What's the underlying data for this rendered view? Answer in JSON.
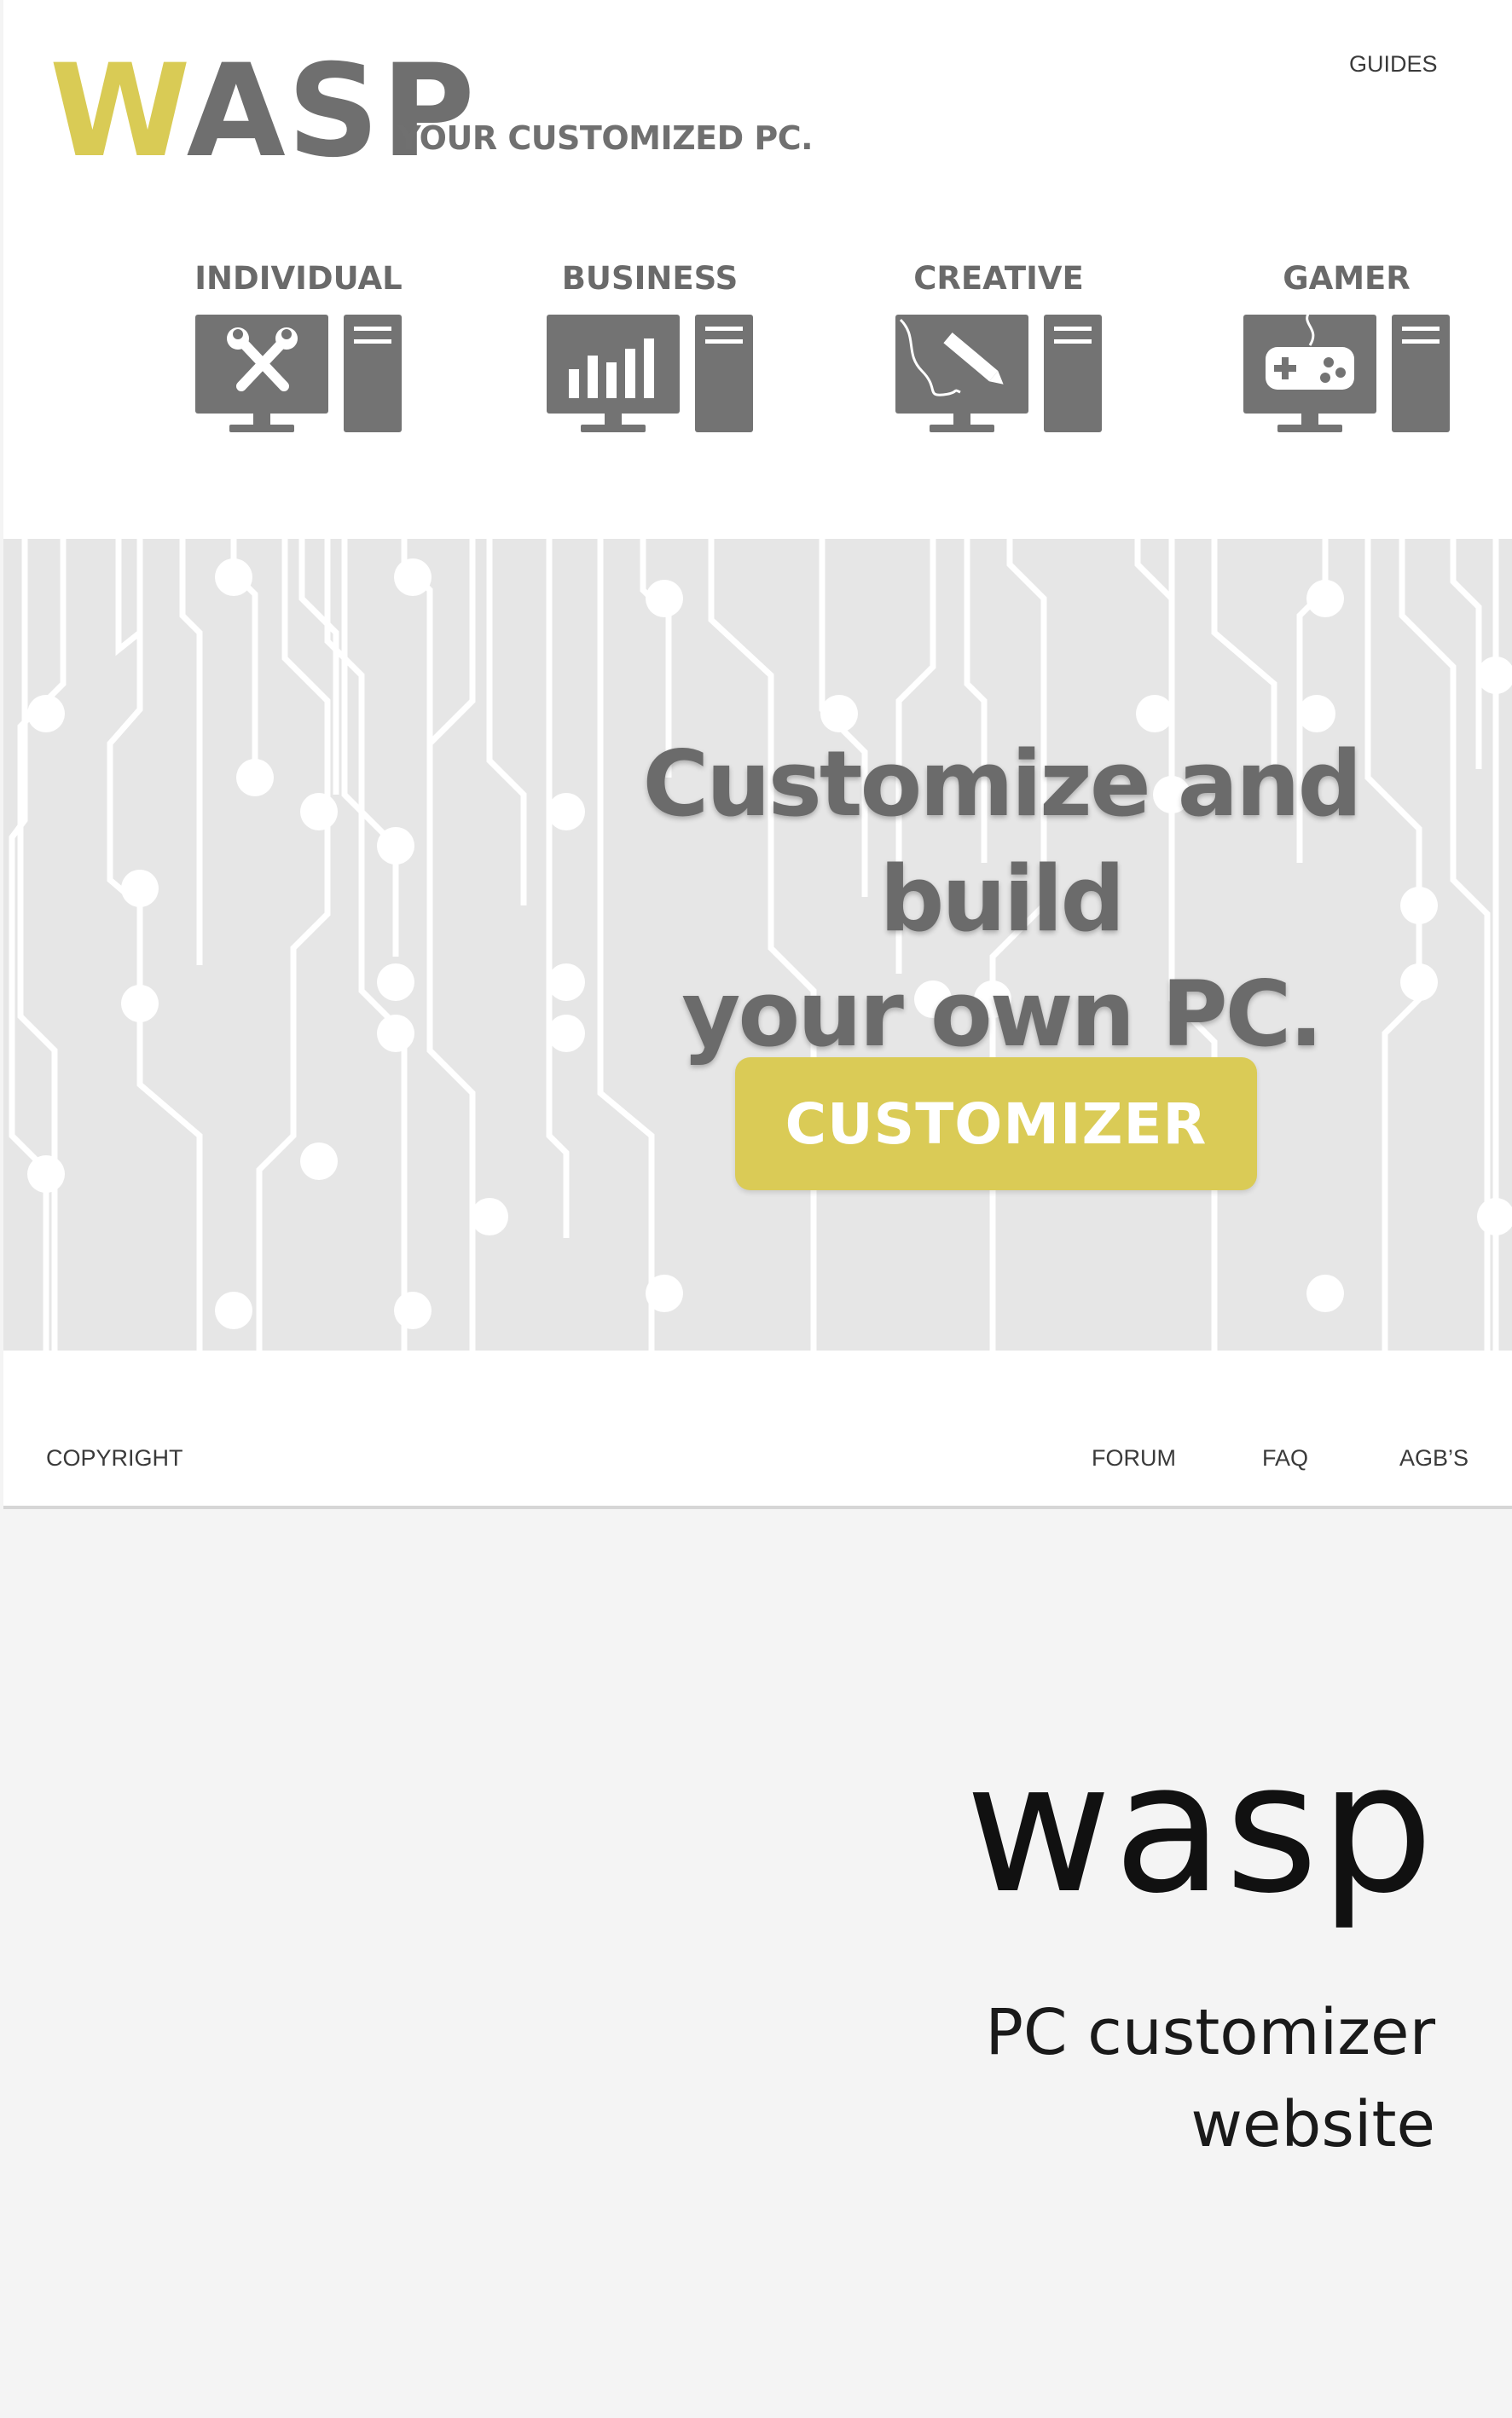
{
  "header": {
    "logo_first_letter": "W",
    "logo_rest": "ASP",
    "tagline": "YOUR CUSTOMIZED PC.",
    "nav_guides": "GUIDES"
  },
  "categories": [
    {
      "label": "INDIVIDUAL",
      "icon": "tools-icon"
    },
    {
      "label": "BUSINESS",
      "icon": "bar-chart-icon"
    },
    {
      "label": "CREATIVE",
      "icon": "pen-icon"
    },
    {
      "label": "GAMER",
      "icon": "gamepad-icon"
    }
  ],
  "hero": {
    "title_line1": "Customize and build",
    "title_line2": "your own PC.",
    "cta_label": "CUSTOMIZER"
  },
  "footer": {
    "copyright": "COPYRIGHT",
    "forum": "FORUM",
    "faq": "FAQ",
    "agb": "AGB’S"
  },
  "caption": {
    "brand": "wasp",
    "desc_line1": "PC customizer",
    "desc_line2": "website"
  },
  "colors": {
    "accent": "#dacb56",
    "icon_gray": "#737373",
    "hero_bg": "#e6e6e6"
  }
}
